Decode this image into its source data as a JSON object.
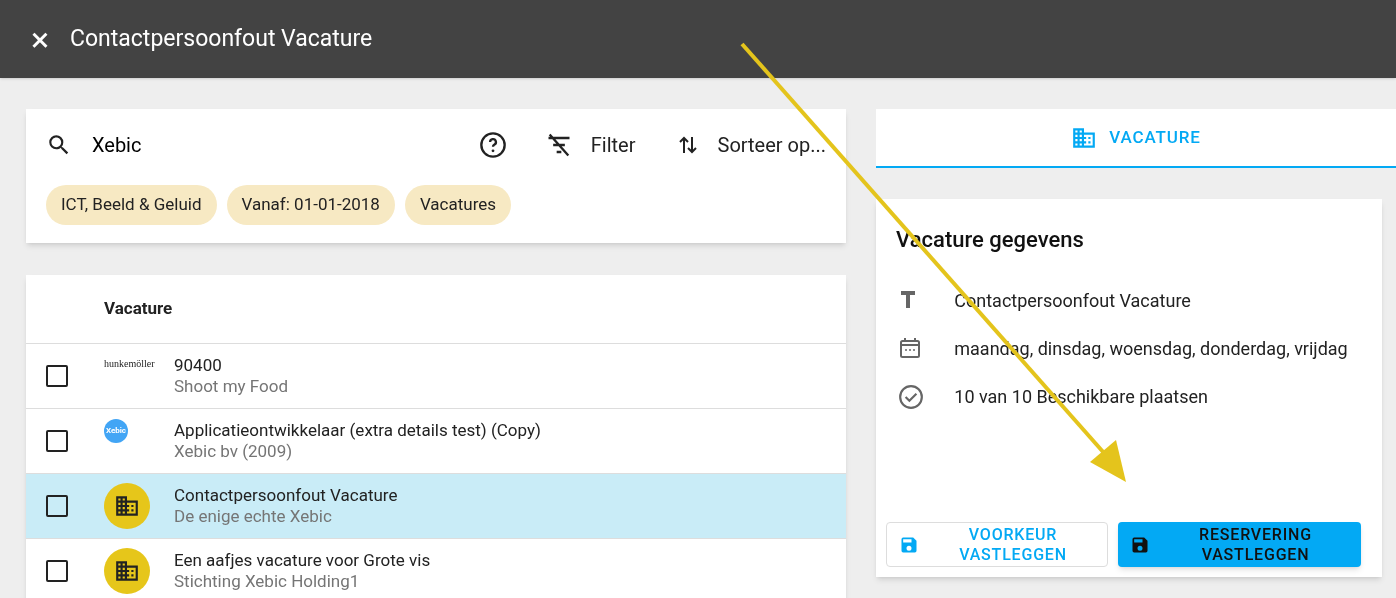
{
  "window": {
    "title": "Contactpersoonfout Vacature",
    "close": "×"
  },
  "search": {
    "value": "Xebic",
    "filter": "Filter",
    "sort": "Sorteer op..."
  },
  "chips": [
    "ICT, Beeld & Geluid",
    "Vanaf: 01-01-2018",
    "Vacatures"
  ],
  "table": {
    "columns": [
      "Vacature"
    ],
    "rows": [
      {
        "kind": "logo-text",
        "logo": "hunkemöller",
        "title": "90400",
        "subtitle": "Shoot my Food",
        "checked": false,
        "selected": false
      },
      {
        "kind": "logo-badge",
        "logo": "Xebic",
        "title": "Applicatieontwikkelaar (extra details test) (Copy)",
        "subtitle": "Xebic bv (2009)",
        "checked": false,
        "selected": false
      },
      {
        "kind": "building",
        "title": "Contactpersoonfout Vacature",
        "subtitle": "De enige echte Xebic",
        "checked": false,
        "selected": true
      },
      {
        "kind": "building",
        "title": "Een aafjes vacature voor Grote vis",
        "subtitle": "Stichting Xebic Holding1",
        "checked": false,
        "selected": false
      }
    ]
  },
  "tabs": [
    {
      "label": "VACATURE",
      "selected": true
    }
  ],
  "details": {
    "heading": "Vacature gegevens",
    "items": [
      {
        "kind": "title",
        "text": "Contactpersoonfout Vacature"
      },
      {
        "kind": "days",
        "text": "maandag, dinsdag, woensdag, donderdag, vrijdag"
      },
      {
        "kind": "places",
        "text": "10 van 10 Beschikbare plaatsen"
      }
    ],
    "buttons": [
      {
        "kind": "outlined",
        "label": "VOORKEUR VASTLEGGEN"
      },
      {
        "kind": "filled",
        "label": "RESERVERING VASTLEGGEN"
      }
    ]
  }
}
